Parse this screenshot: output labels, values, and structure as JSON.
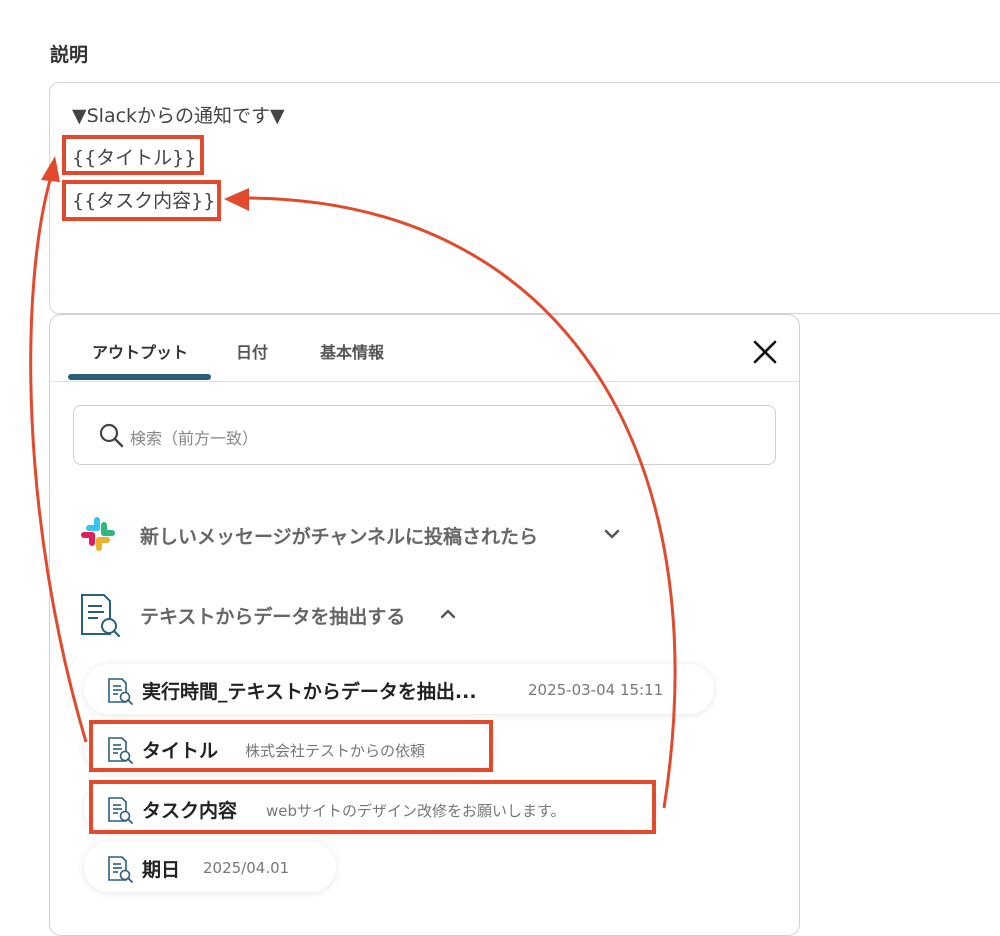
{
  "field": {
    "label": "説明",
    "lines": [
      "▼Slackからの通知です▼",
      "{{タイトル}}",
      "{{タスク内容}}"
    ]
  },
  "panel": {
    "tabs": [
      "アウトプット",
      "日付",
      "基本情報"
    ],
    "active_tab": "アウトプット",
    "close_icon": "close-icon",
    "search": {
      "placeholder": "検索（前方一致）",
      "icon": "search-icon"
    },
    "sections": [
      {
        "label": "新しいメッセージがチャンネルに投稿されたら",
        "icon": "slack-logo",
        "expanded": false
      },
      {
        "label": "テキストからデータを抽出する",
        "icon": "document-search-icon",
        "expanded": true
      }
    ],
    "items": [
      {
        "name": "実行時間_テキストからデータを抽出...",
        "value": "2025-03-04 15:11"
      },
      {
        "name": "タイトル",
        "value": "株式会社テストからの依頼"
      },
      {
        "name": "タスク内容",
        "value": "webサイトのデザイン改修をお願いします。"
      },
      {
        "name": "期日",
        "value": "2025/04.01"
      }
    ]
  },
  "colors": {
    "annotation": "#e14a2d",
    "tab_indicator": "#2a5f7a",
    "slack": [
      "#36c5f0",
      "#2eb67d",
      "#ecb22e",
      "#e01e5a"
    ]
  }
}
